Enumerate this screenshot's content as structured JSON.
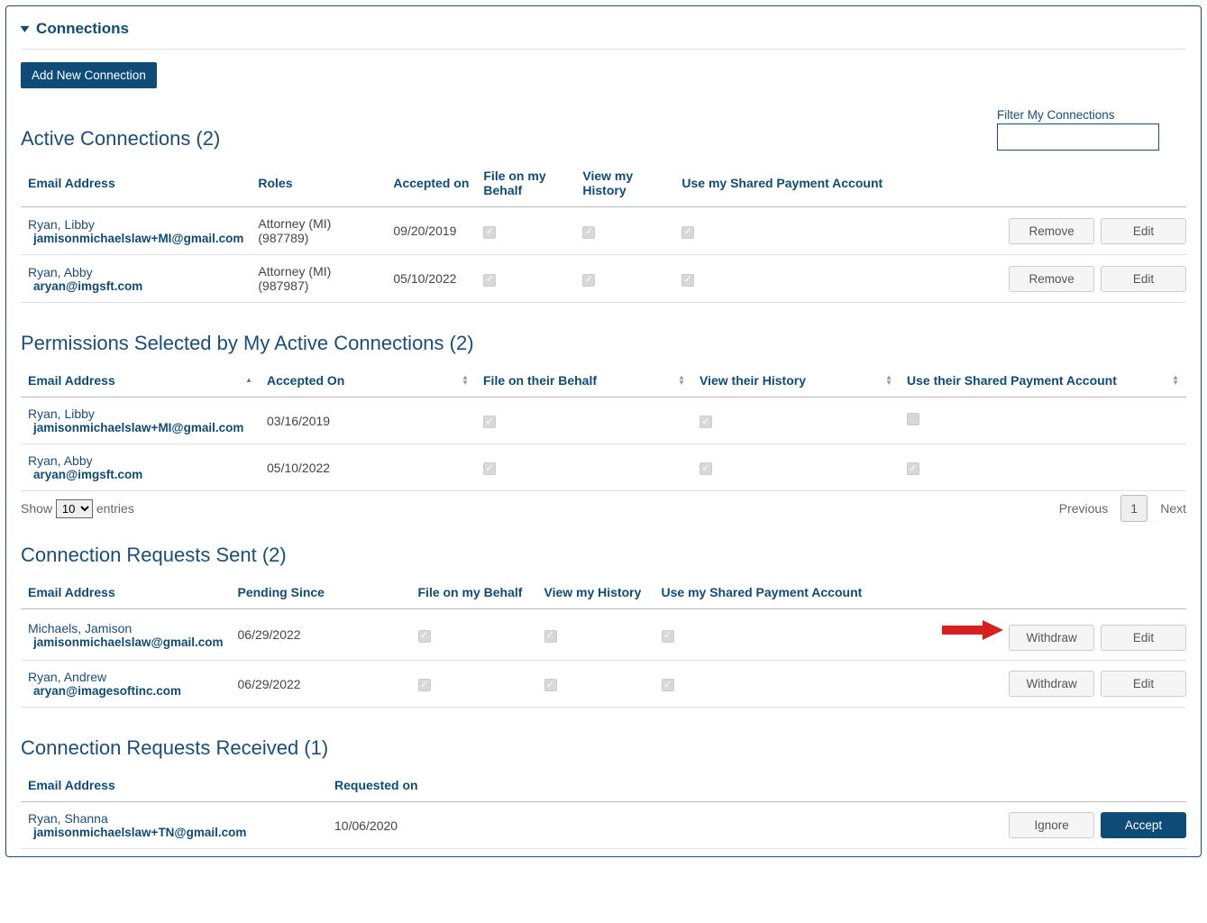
{
  "header": {
    "title": "Connections"
  },
  "buttons": {
    "add_new": "Add New Connection",
    "remove": "Remove",
    "edit": "Edit",
    "withdraw": "Withdraw",
    "ignore": "Ignore",
    "accept": "Accept"
  },
  "filter": {
    "label": "Filter My Connections",
    "value": ""
  },
  "active": {
    "title": "Active Connections (2)",
    "headers": [
      "Email Address",
      "Roles",
      "Accepted on",
      "File on my Behalf",
      "View my History",
      "Use my Shared Payment Account",
      ""
    ],
    "rows": [
      {
        "name": "Ryan, Libby",
        "email": "jamisonmichaelslaw+MI@gmail.com",
        "role": "Attorney (MI) (987789)",
        "accepted": "09/20/2019",
        "file": true,
        "view": true,
        "use": true
      },
      {
        "name": "Ryan, Abby",
        "email": "aryan@imgsft.com",
        "role": "Attorney (MI) (987987)",
        "accepted": "05/10/2022",
        "file": true,
        "view": true,
        "use": true
      }
    ]
  },
  "perms": {
    "title": "Permissions Selected by My Active Connections (2)",
    "headers": [
      "Email Address",
      "Accepted On",
      "File on their Behalf",
      "View their History",
      "Use their Shared Payment Account"
    ],
    "rows": [
      {
        "name": "Ryan, Libby",
        "email": "jamisonmichaelslaw+MI@gmail.com",
        "accepted": "03/16/2019",
        "file": true,
        "view": true,
        "use": false
      },
      {
        "name": "Ryan, Abby",
        "email": "aryan@imgsft.com",
        "accepted": "05/10/2022",
        "file": true,
        "view": true,
        "use": true
      }
    ],
    "pager": {
      "show_label": "Show",
      "entries_label": "entries",
      "show_value": "10",
      "prev": "Previous",
      "next": "Next",
      "page": "1"
    }
  },
  "sent": {
    "title": "Connection Requests Sent (2)",
    "headers": [
      "Email Address",
      "Pending Since",
      "File on my Behalf",
      "View my History",
      "Use my Shared Payment Account",
      ""
    ],
    "rows": [
      {
        "name": "Michaels, Jamison",
        "email": "jamisonmichaelslaw@gmail.com",
        "pending": "06/29/2022",
        "file": true,
        "view": true,
        "use": true,
        "annot": true
      },
      {
        "name": "Ryan, Andrew",
        "email": "aryan@imagesoftinc.com",
        "pending": "06/29/2022",
        "file": true,
        "view": true,
        "use": true,
        "annot": false
      }
    ]
  },
  "received": {
    "title": "Connection Requests Received (1)",
    "headers": [
      "Email Address",
      "Requested on",
      ""
    ],
    "rows": [
      {
        "name": "Ryan, Shanna",
        "email": "jamisonmichaelslaw+TN@gmail.com",
        "requested": "10/06/2020"
      }
    ]
  }
}
